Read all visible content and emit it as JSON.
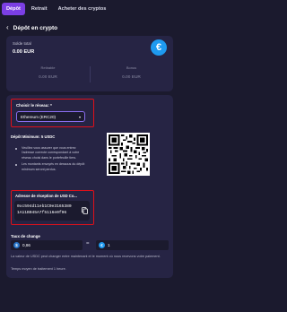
{
  "tabs": [
    {
      "label": "Dépôt",
      "active": true
    },
    {
      "label": "Retrait",
      "active": false
    },
    {
      "label": "Acheter des cryptos",
      "active": false
    }
  ],
  "header": {
    "back_glyph": "‹",
    "title": "Dépôt en crypto"
  },
  "balance": {
    "label": "Solde total",
    "value": "0.00 EUR",
    "currency_glyph": "€",
    "withdrawable_label": "Retirable",
    "withdrawable_value": "0.00 EUR",
    "bonus_label": "Bonus",
    "bonus_value": "0.00 EUR"
  },
  "network": {
    "label": "Choisir le réseau: *",
    "selected": "Ethereum (ERC20)",
    "chevron": "▾"
  },
  "minimum": {
    "title": "Dépôt Minimum: 5 USDC"
  },
  "notes": [
    "Veuillez vous assurer que vous entrez l'adresse correcte correspondant à votre réseau choisi dans le portefeuille tiers.",
    "Les montants envoyés en dessous du dépôt minimum seront perdus."
  ],
  "address": {
    "label": "Adresse de réception de USD Co...",
    "line1": "0xc594d11eb1C0e3165380",
    "line2": "1A11B045A7f5116e0f96"
  },
  "rate": {
    "title": "Taux de change",
    "from_value": "0,86",
    "to_value": "1",
    "equals": "=",
    "usdc_glyph": "$",
    "eur_glyph": "€",
    "disclaimer": "La valeur de USDC peut changer entre maintenant et le moment où nous recevons votre paiement.",
    "processing": "Temps moyen de traitement 1 heure."
  },
  "colors": {
    "accent": "#7b3fe4",
    "highlight": "#e0101a",
    "background": "#1b1a2e",
    "card": "#262444",
    "euro_badge": "#1e9af0"
  }
}
